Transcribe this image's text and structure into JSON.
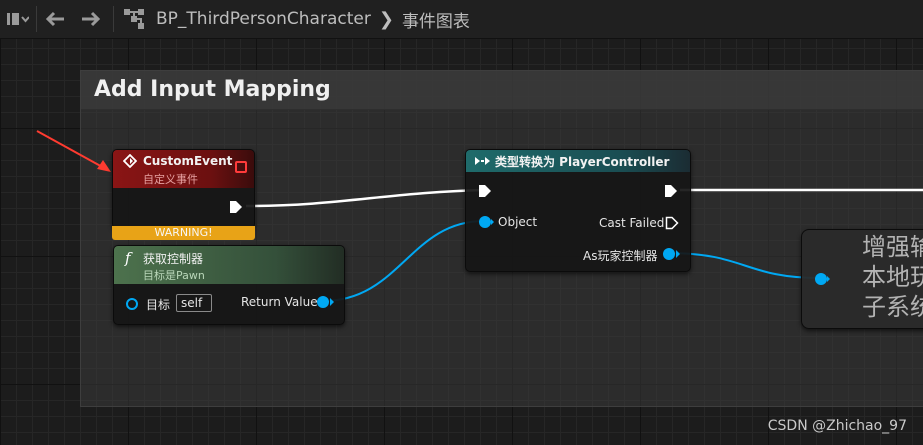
{
  "breadcrumb": {
    "blueprint": "BP_ThirdPersonCharacter",
    "graph": "事件图表"
  },
  "comment": {
    "title": "Add Input Mapping"
  },
  "custom_event": {
    "title": "CustomEvent",
    "subtitle": "自定义事件",
    "warning": "WARNING!"
  },
  "get_controller": {
    "icon": "f",
    "title": "获取控制器",
    "subtitle": "目标是Pawn",
    "target_label": "目标",
    "target_value": "self",
    "return_label": "Return Value"
  },
  "cast_node": {
    "title": "类型转换为 PlayerController",
    "object_label": "Object",
    "cast_failed_label": "Cast Failed",
    "as_label": "As玩家控制器"
  },
  "subsystem_node": {
    "line1": "增强输",
    "line2": "本地玩",
    "line3": "子系统"
  },
  "watermark": "CSDN @Zhichao_97",
  "colors": {
    "event_header": "#8a1515",
    "function_header": "#3b5e3b",
    "cast_header": "#1e5a5a",
    "warning": "#e8a317",
    "object_pin": "#00a8f3",
    "exec_pin": "#ffffff",
    "annotation_arrow": "#ff3b30"
  }
}
